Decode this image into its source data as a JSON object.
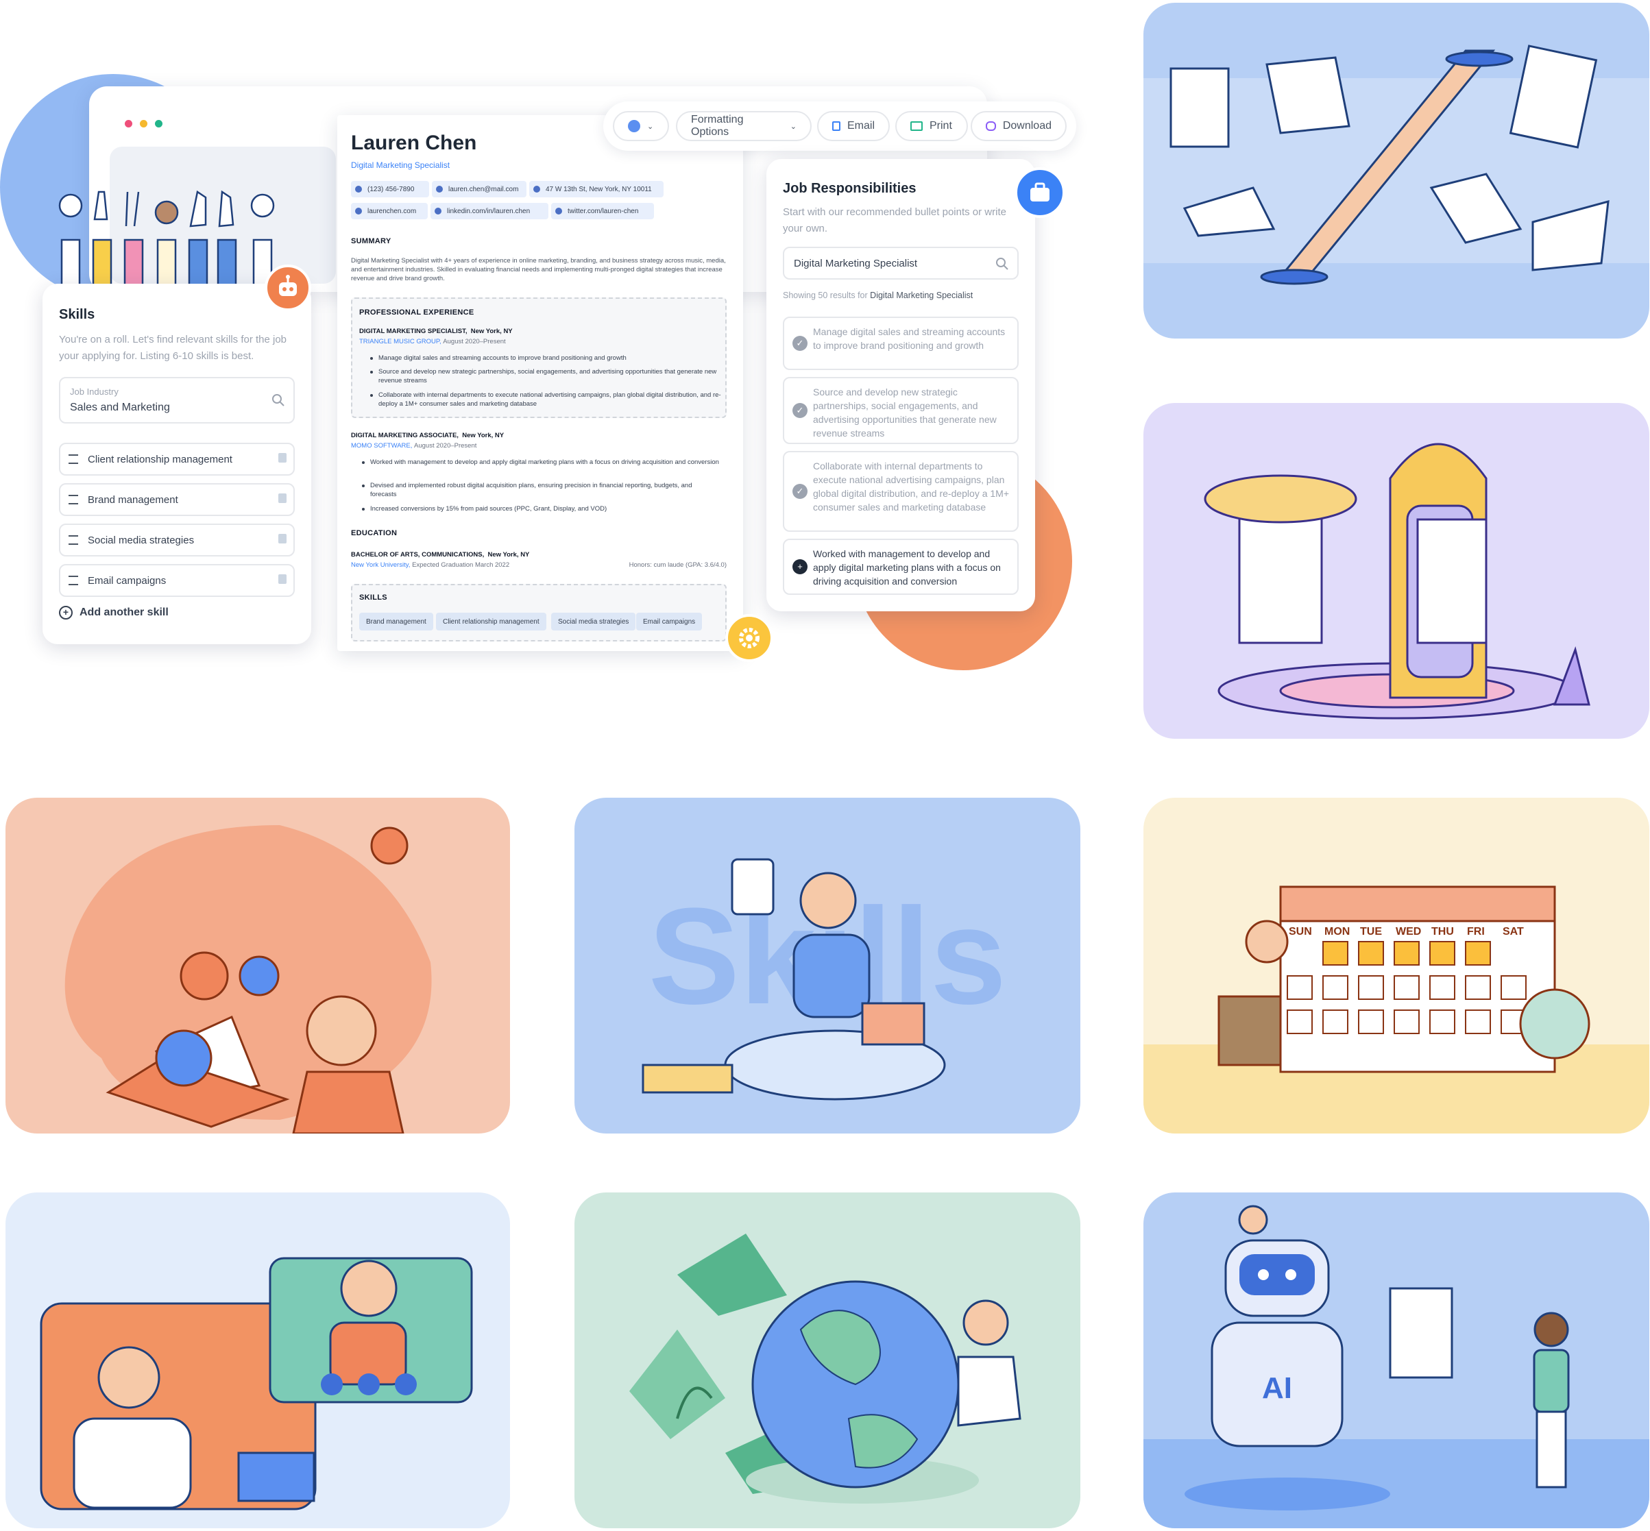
{
  "colors": {
    "accent_blue": "#3b82f6",
    "orange": "#f28a5a",
    "yellow": "#fbbf3c",
    "soft_blue_bg": "#b6cff5"
  },
  "toolbar": {
    "color_icon": "color-dot-icon",
    "formatting_label": "Formatting Options",
    "email_label": "Email",
    "print_label": "Print",
    "download_label": "Download"
  },
  "skills_panel": {
    "title": "Skills",
    "description": "You're on a roll. Let's find relevant skills for the job your applying for. Listing 6-10 skills is best.",
    "industry_label": "Job Industry",
    "industry_value": "Sales and Marketing",
    "items": [
      "Client relationship management",
      "Brand management",
      "Social media strategies",
      "Email campaigns"
    ],
    "add_label": "Add another skill"
  },
  "resume": {
    "name": "Lauren Chen",
    "title": "Digital Marketing Specialist",
    "phone": "(123) 456-7890",
    "email": "lauren.chen@mail.com",
    "address": "47 W 13th St, New York, NY 10011",
    "website": "laurenchen.com",
    "linkedin": "linkedin.com/in/lauren.chen",
    "twitter": "twitter.com/lauren-chen",
    "summary_heading": "SUMMARY",
    "summary": "Digital Marketing Specialist with 4+ years of experience in online marketing, branding, and business strategy across music, media, and entertainment industries. Skilled in evaluating financial needs and implementing multi-pronged digital strategies that increase revenue and drive brand growth.",
    "experience_heading": "PROFESSIONAL EXPERIENCE",
    "job1_title": "DIGITAL MARKETING SPECIALIST,",
    "job1_location": "New York, NY",
    "job1_company": "TRIANGLE MUSIC GROUP,",
    "job1_dates": "August 2020–Present",
    "job1_bullets": [
      "Manage digital sales and streaming accounts to improve brand positioning and growth",
      "Source and develop new strategic partnerships, social engagements, and advertising opportunities that generate new revenue streams",
      "Collaborate with internal departments to execute national advertising campaigns, plan global digital distribution, and re-deploy a 1M+ consumer sales and marketing database"
    ],
    "job2_title": "DIGITAL MARKETING ASSOCIATE,",
    "job2_location": "New York, NY",
    "job2_company": "MOMO SOFTWARE,",
    "job2_dates": "August 2020–Present",
    "job2_bullets": [
      "Worked with management to develop and apply digital marketing plans with a focus on driving acquisition and conversion",
      "Devised and implemented robust digital acquisition plans, ensuring precision in financial reporting, budgets, and forecasts",
      "Increased conversions by 15% from paid sources (PPC, Grant, Display, and VOD)"
    ],
    "education_heading": "EDUCATION",
    "degree": "BACHELOR OF ARTS, COMMUNICATIONS,",
    "degree_location": "New York, NY",
    "school": "New York University,",
    "graduation": "Expected Graduation March 2022",
    "honors": "Honors: cum laude (GPA: 3.6/4.0)",
    "skills_heading": "SKILLS",
    "skills": [
      "Brand management",
      "Client relationship management",
      "Social media strategies",
      "Email campaigns"
    ]
  },
  "responsibilities_panel": {
    "title": "Job Responsibilities",
    "description": "Start with our recommended bullet points or write your own.",
    "search_value": "Digital Marketing Specialist",
    "results_prefix": "Showing 50 results for",
    "results_query": "Digital Marketing Specialist",
    "items": [
      "Manage digital sales and streaming accounts to improve brand positioning and growth",
      "Source and develop new strategic partnerships, social engagements, and advertising opportunities that generate new revenue streams",
      "Collaborate with internal departments to execute national advertising campaigns, plan global digital distribution, and re-deploy a 1M+ consumer sales and marketing database"
    ],
    "add_item": "Worked with management to develop and apply digital marketing plans with a focus on driving acquisition and conversion"
  },
  "illustrations": {
    "skills_word": "Skills",
    "calendar_days": [
      "SUN",
      "MON",
      "TUE",
      "WED",
      "THU",
      "FRI",
      "SAT"
    ],
    "ai_label": "AI"
  }
}
